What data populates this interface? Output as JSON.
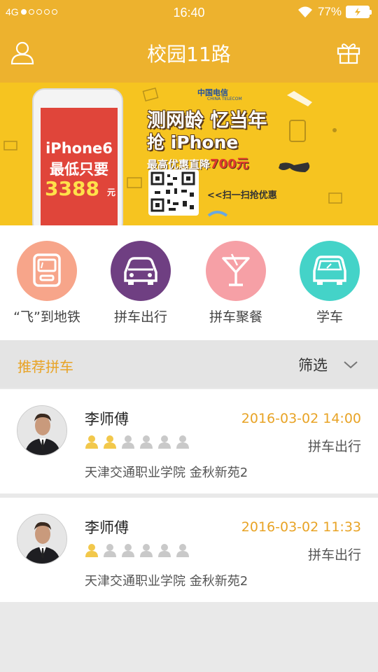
{
  "status_bar": {
    "network": "4G",
    "time": "16:40",
    "battery": "77%",
    "signal_dots_filled": 1,
    "signal_dots_total": 5
  },
  "header": {
    "title": "校园11路",
    "user_icon": "user-icon",
    "gift_icon": "gift-icon"
  },
  "banner": {
    "phone_line1": "iPhone6",
    "phone_line2": "最低只要",
    "phone_price": "3388",
    "phone_unit": "元",
    "telecom_name": "中国电信",
    "telecom_en": "CHINA TELECOM",
    "headline1": "测网龄 忆当年",
    "headline2": "抢 iPhone",
    "offer_prefix": "最高优惠直降",
    "offer_amount": "700元",
    "scan_text": "<<扫一扫抢优惠"
  },
  "quick_actions": [
    {
      "label": "“飞”到地铁",
      "icon": "bus-icon",
      "color": "#f7a58a"
    },
    {
      "label": "拼车出行",
      "icon": "car-icon",
      "color": "#6f3f82"
    },
    {
      "label": "拼车聚餐",
      "icon": "cocktail-icon",
      "color": "#f6a0a6"
    },
    {
      "label": "学车",
      "icon": "learner-car-icon",
      "color": "#44d3c8"
    }
  ],
  "section": {
    "title": "推荐拼车",
    "filter_label": "筛选"
  },
  "rides": [
    {
      "name": "李师傅",
      "time": "2016-03-02 14:00",
      "type": "拼车出行",
      "route": "天津交通职业学院 金秋新苑2",
      "rating": 2,
      "rating_max": 6
    },
    {
      "name": "李师傅",
      "time": "2016-03-02 11:33",
      "type": "拼车出行",
      "route": "天津交通职业学院 金秋新苑2",
      "rating": 1,
      "rating_max": 6
    }
  ],
  "colors": {
    "brand": "#edb22e",
    "accent_text": "#e8a325",
    "star_on": "#f2c84b",
    "star_off": "#c9c9c9"
  }
}
